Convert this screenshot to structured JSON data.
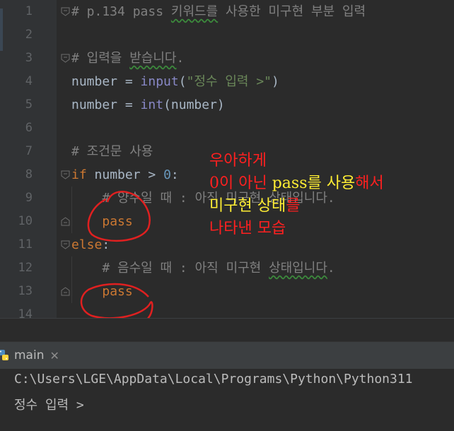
{
  "editor": {
    "lines": [
      {
        "num": "1",
        "parts": [
          {
            "t": "# p.134 pass ",
            "c": "cm"
          },
          {
            "t": "키워드를",
            "c": "cm sq"
          },
          {
            "t": " 사용한 미구현 부분 입력",
            "c": "cm"
          }
        ]
      },
      {
        "num": "2",
        "parts": []
      },
      {
        "num": "3",
        "parts": [
          {
            "t": "# 입력을 ",
            "c": "cm"
          },
          {
            "t": "받습니다",
            "c": "cm sq"
          },
          {
            "t": ".",
            "c": "cm"
          }
        ]
      },
      {
        "num": "4",
        "parts": [
          {
            "t": "number = ",
            "c": "op"
          },
          {
            "t": "input",
            "c": "bi"
          },
          {
            "t": "(",
            "c": "op"
          },
          {
            "t": "\"정수 입력 >\"",
            "c": "str"
          },
          {
            "t": ")",
            "c": "op"
          }
        ]
      },
      {
        "num": "5",
        "parts": [
          {
            "t": "number = ",
            "c": "op"
          },
          {
            "t": "int",
            "c": "bi"
          },
          {
            "t": "(number)",
            "c": "op"
          }
        ]
      },
      {
        "num": "6",
        "parts": []
      },
      {
        "num": "7",
        "parts": [
          {
            "t": "# 조건문 사용",
            "c": "cm"
          }
        ]
      },
      {
        "num": "8",
        "parts": [
          {
            "t": "if",
            "c": "kw"
          },
          {
            "t": " number > ",
            "c": "op"
          },
          {
            "t": "0",
            "c": "num"
          },
          {
            "t": ":",
            "c": "op"
          }
        ]
      },
      {
        "num": "9",
        "parts": [
          {
            "t": "    # 양수일 때 : 아직 미구현 상태입니다.",
            "c": "cm"
          }
        ]
      },
      {
        "num": "10",
        "parts": [
          {
            "t": "    ",
            "c": "op"
          },
          {
            "t": "pass",
            "c": "kw"
          }
        ]
      },
      {
        "num": "11",
        "parts": [
          {
            "t": "else",
            "c": "kw"
          },
          {
            "t": ":",
            "c": "op"
          }
        ]
      },
      {
        "num": "12",
        "parts": [
          {
            "t": "    # 음수일 때 : 아직 미구현 ",
            "c": "cm"
          },
          {
            "t": "상태입니다",
            "c": "cm sq"
          },
          {
            "t": ".",
            "c": "cm"
          }
        ]
      },
      {
        "num": "13",
        "parts": [
          {
            "t": "    ",
            "c": "op"
          },
          {
            "t": "pass",
            "c": "kw"
          }
        ]
      },
      {
        "num": "14",
        "parts": []
      }
    ]
  },
  "annotation": {
    "lines": [
      [
        {
          "t": "우아하게",
          "color": "red"
        }
      ],
      [
        {
          "t": "0이 아닌 ",
          "color": "red"
        },
        {
          "t": "pass를 사용",
          "color": "yellow"
        },
        {
          "t": "해서",
          "color": "red"
        }
      ],
      [
        {
          "t": "미구현 상태",
          "color": "yellow"
        },
        {
          "t": "를",
          "color": "red"
        }
      ],
      [
        {
          "t": "나타낸 모습",
          "color": "red"
        }
      ]
    ]
  },
  "run_panel": {
    "tab_label": "main",
    "close_glyph": "✕"
  },
  "console": {
    "lines": [
      "C:\\Users\\LGE\\AppData\\Local\\Programs\\Python\\Python311",
      "정수 입력 >"
    ]
  },
  "colors": {
    "background": "#2b2b2b",
    "keyword": "#cc7832",
    "comment": "#808080",
    "string": "#6a8759",
    "builtin": "#8888c6",
    "number": "#6897bb",
    "annotation_red": "#ff2020",
    "annotation_yellow": "#ffee33"
  },
  "icons": [
    "python-icon",
    "close-icon",
    "fold-icon"
  ]
}
